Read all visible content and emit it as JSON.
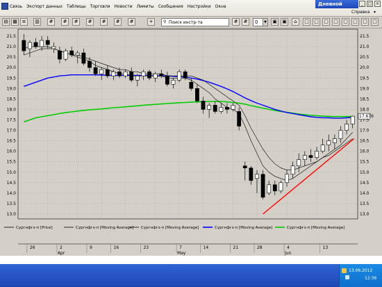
{
  "menu": {
    "items": [
      "Связь",
      "Экспорт данных",
      "Таблицы",
      "Торговля",
      "Новости",
      "Лимиты",
      "Сообщения",
      "Настройки",
      "Окна"
    ],
    "help": "Справка"
  },
  "window": {
    "title": "Дневной",
    "controls": [
      "_",
      "□",
      "×"
    ]
  },
  "toolbar": {
    "search_placeholder": "Поиск инстр-та",
    "zoom_value": "0",
    "icons": [
      "printer-icon",
      "table-icon",
      "orders-icon",
      "chart-icon",
      "grid-icon",
      "grid-icon",
      "grid-icon",
      "grid-icon",
      "grid-icon",
      "grid-icon",
      "grid-icon",
      "add-icon"
    ],
    "right_icons": [
      "hash-icon",
      "hash-icon",
      "tile-icon",
      "tile-icon",
      "lock-icon",
      "window-icon",
      "window-icon",
      "window-icon",
      "window-icon",
      "window-icon",
      "window-icon",
      "window-icon",
      "window-icon"
    ]
  },
  "chart_data": {
    "type": "line",
    "ylim": [
      12.8,
      21.8
    ],
    "y_ticks": [
      "21.5",
      "21.0",
      "20.5",
      "20.0",
      "19.5",
      "19.0",
      "18.5",
      "18.0",
      "17.5",
      "17.0",
      "16.5",
      "16.0",
      "15.5",
      "15.0",
      "14.5",
      "14.0",
      "13.5",
      "13.0"
    ],
    "y_ticks_right": [
      "21.5",
      "21.0",
      "20.5",
      "20.0",
      "19.5",
      "19.0",
      "18.5",
      "18.0",
      "17.5",
      "17.0",
      "16.5",
      "16.0",
      "15.5",
      "15.0",
      "14.5",
      "14.0",
      "13.5",
      "13.0"
    ],
    "last_price_label": "17.676",
    "last_price": 17.676,
    "x_day_labels": [
      "26",
      "2",
      "9",
      "16",
      "23",
      "7",
      "14",
      "21",
      "28",
      "4",
      "13"
    ],
    "x_month_labels": [
      "Apr",
      "May",
      "Jun"
    ],
    "legend": [
      {
        "label": "Сургнфгз-п [Price]",
        "color": "#000000"
      },
      {
        "label": "Сургнфгз-п [Moving Average]",
        "color": "#000000"
      },
      {
        "label": "Сургнфгз-п [Moving Average]",
        "color": "#000000"
      },
      {
        "label": "Сургнфгз-п [Moving Average]",
        "color": "#0000ff"
      },
      {
        "label": "Сургнфгз-п [Moving Average]",
        "color": "#00cc00"
      }
    ],
    "candles": [
      [
        21.3,
        21.6,
        20.6,
        20.8
      ],
      [
        20.9,
        21.3,
        20.5,
        21.2
      ],
      [
        21.2,
        21.4,
        20.9,
        21.0
      ],
      [
        21.0,
        21.5,
        20.8,
        21.3
      ],
      [
        21.3,
        21.5,
        20.9,
        21.1
      ],
      [
        20.9,
        21.2,
        20.7,
        21.0
      ],
      [
        20.8,
        21.0,
        20.2,
        20.4
      ],
      [
        20.4,
        20.9,
        20.3,
        20.8
      ],
      [
        20.8,
        21.0,
        20.5,
        20.6
      ],
      [
        20.6,
        20.8,
        20.2,
        20.7
      ],
      [
        20.7,
        20.9,
        20.1,
        20.2
      ],
      [
        20.3,
        20.5,
        19.8,
        20.0
      ],
      [
        20.0,
        20.3,
        19.6,
        19.7
      ],
      [
        19.7,
        20.0,
        19.4,
        19.9
      ],
      [
        19.9,
        20.1,
        19.5,
        19.6
      ],
      [
        19.6,
        19.9,
        19.4,
        19.8
      ],
      [
        19.8,
        20.0,
        19.5,
        19.6
      ],
      [
        19.6,
        19.9,
        19.5,
        19.8
      ],
      [
        19.8,
        20.0,
        19.3,
        19.4
      ],
      [
        19.4,
        19.7,
        19.1,
        19.6
      ],
      [
        19.6,
        19.9,
        19.4,
        19.8
      ],
      [
        19.8,
        19.9,
        19.4,
        19.5
      ],
      [
        19.5,
        19.8,
        19.3,
        19.7
      ],
      [
        19.7,
        19.9,
        19.5,
        19.6
      ],
      [
        19.6,
        19.8,
        19.1,
        19.2
      ],
      [
        19.2,
        19.5,
        19.0,
        19.4
      ],
      [
        19.4,
        19.9,
        19.3,
        19.8
      ],
      [
        19.8,
        19.9,
        19.4,
        19.5
      ],
      [
        19.3,
        19.5,
        18.9,
        19.0
      ],
      [
        19.0,
        19.2,
        18.3,
        18.4
      ],
      [
        18.4,
        18.6,
        17.8,
        18.0
      ],
      [
        18.0,
        18.3,
        17.6,
        18.2
      ],
      [
        18.2,
        18.4,
        17.8,
        17.9
      ],
      [
        17.9,
        18.3,
        17.8,
        18.1
      ],
      [
        18.1,
        18.3,
        17.8,
        18.0
      ],
      [
        18.0,
        18.3,
        17.9,
        18.2
      ],
      [
        17.9,
        18.1,
        17.0,
        17.2
      ],
      [
        15.3,
        15.5,
        14.6,
        15.2
      ],
      [
        15.2,
        15.3,
        14.4,
        14.6
      ],
      [
        14.7,
        15.1,
        14.0,
        14.9
      ],
      [
        14.9,
        15.1,
        13.7,
        13.8
      ],
      [
        14.0,
        14.6,
        13.9,
        14.4
      ],
      [
        14.4,
        14.6,
        13.9,
        14.1
      ],
      [
        14.1,
        14.6,
        14.0,
        14.5
      ],
      [
        14.5,
        15.1,
        14.3,
        14.9
      ],
      [
        14.9,
        15.5,
        14.7,
        15.3
      ],
      [
        15.3,
        15.9,
        15.0,
        15.6
      ],
      [
        15.6,
        16.0,
        15.3,
        15.8
      ],
      [
        15.8,
        16.1,
        15.5,
        15.7
      ],
      [
        15.7,
        16.2,
        15.6,
        16.0
      ],
      [
        16.0,
        16.6,
        15.9,
        16.3
      ],
      [
        16.3,
        16.8,
        16.0,
        16.5
      ],
      [
        16.4,
        16.8,
        16.1,
        16.6
      ],
      [
        16.6,
        17.2,
        16.4,
        17.0
      ],
      [
        17.0,
        17.5,
        16.8,
        17.3
      ],
      [
        17.3,
        17.7,
        17.1,
        17.676
      ]
    ],
    "ma_fast": [
      20.9,
      21.0,
      21.0,
      21.0,
      21.0,
      20.9,
      20.8,
      20.7,
      20.6,
      20.5,
      20.4,
      20.3,
      20.1,
      20.0,
      19.9,
      19.8,
      19.7,
      19.7,
      19.6,
      19.6,
      19.6,
      19.6,
      19.6,
      19.6,
      19.5,
      19.5,
      19.5,
      19.5,
      19.4,
      19.2,
      19.0,
      18.8,
      18.5,
      18.3,
      18.1,
      18.0,
      17.8,
      17.2,
      16.5,
      15.9,
      15.3,
      15.0,
      14.8,
      14.7,
      14.6,
      14.7,
      14.9,
      15.1,
      15.3,
      15.5,
      15.7,
      15.9,
      16.1,
      16.3,
      16.6,
      16.9
    ],
    "ma_mid": [
      20.6,
      20.7,
      20.8,
      20.9,
      20.9,
      20.9,
      20.8,
      20.7,
      20.6,
      20.6,
      20.5,
      20.4,
      20.3,
      20.2,
      20.1,
      20.0,
      19.9,
      19.9,
      19.8,
      19.8,
      19.7,
      19.7,
      19.7,
      19.7,
      19.6,
      19.6,
      19.6,
      19.6,
      19.6,
      19.5,
      19.4,
      19.2,
      19.0,
      18.8,
      18.6,
      18.4,
      18.2,
      17.7,
      17.1,
      16.6,
      16.1,
      15.7,
      15.4,
      15.2,
      15.1,
      15.1,
      15.2,
      15.3,
      15.4,
      15.5,
      15.7,
      15.8,
      16.0,
      16.2,
      16.4,
      16.6
    ],
    "ma_blue": [
      19.1,
      19.2,
      19.3,
      19.4,
      19.5,
      19.55,
      19.6,
      19.62,
      19.65,
      19.65,
      19.65,
      19.65,
      19.65,
      19.64,
      19.63,
      19.62,
      19.62,
      19.62,
      19.62,
      19.62,
      19.62,
      19.62,
      19.6,
      19.6,
      19.6,
      19.58,
      19.56,
      19.55,
      19.5,
      19.45,
      19.38,
      19.3,
      19.2,
      19.1,
      18.98,
      18.85,
      18.7,
      18.55,
      18.42,
      18.3,
      18.2,
      18.1,
      18.0,
      17.92,
      17.85,
      17.8,
      17.75,
      17.7,
      17.65,
      17.62,
      17.6,
      17.6,
      17.58,
      17.58,
      17.6,
      17.62
    ],
    "ma_green": [
      17.4,
      17.5,
      17.6,
      17.65,
      17.7,
      17.75,
      17.8,
      17.85,
      17.88,
      17.92,
      17.95,
      17.98,
      18.0,
      18.02,
      18.05,
      18.08,
      18.1,
      18.12,
      18.15,
      18.17,
      18.2,
      18.22,
      18.24,
      18.26,
      18.28,
      18.3,
      18.32,
      18.33,
      18.35,
      18.36,
      18.37,
      18.38,
      18.38,
      18.38,
      18.36,
      18.33,
      18.3,
      18.25,
      18.18,
      18.12,
      18.06,
      18.0,
      17.95,
      17.9,
      17.86,
      17.82,
      17.78,
      17.75,
      17.72,
      17.7,
      17.68,
      17.67,
      17.66,
      17.66,
      17.66,
      17.66
    ],
    "trend_line": {
      "from_index": 40,
      "from_value": 13.0,
      "to_index": 55,
      "to_value": 16.6,
      "color": "#ff0000"
    }
  },
  "taskbar": {
    "date": "13.06.2012",
    "time": "12:36"
  }
}
